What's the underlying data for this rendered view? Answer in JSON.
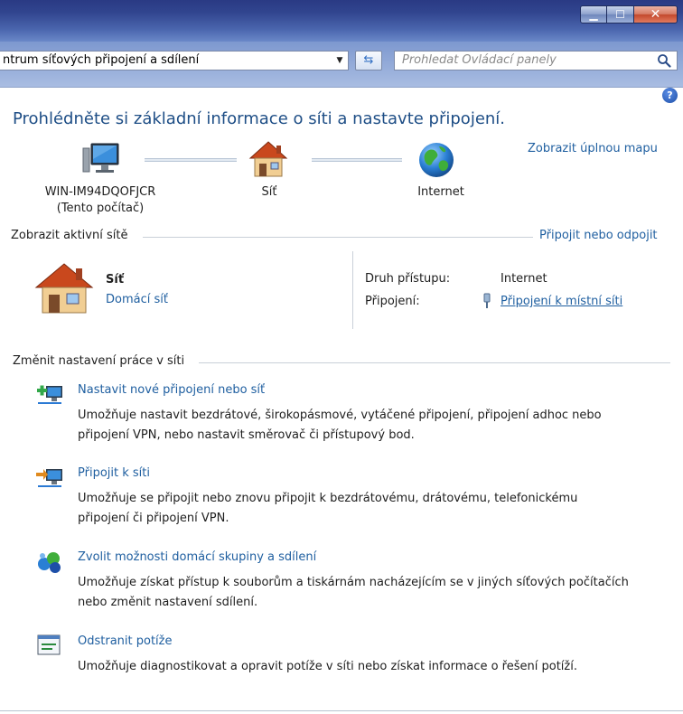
{
  "window": {
    "minimize_glyph": "▁",
    "maximize_glyph": "☐",
    "close_glyph": "✕"
  },
  "address_bar": {
    "path": "ntrum síťových připojení a sdílení",
    "dropdown_glyph": "▼",
    "refresh_glyph": "⇆",
    "search_placeholder": "Prohledat Ovládací panely"
  },
  "help_glyph": "?",
  "page_title": "Prohlédněte si základní informace o síti a nastavte připojení.",
  "full_map_link": "Zobrazit úplnou mapu",
  "network_map": {
    "computer": {
      "name": "WIN-IM94DQOFJCR",
      "subtitle": "(Tento počítač)"
    },
    "network": {
      "name": "Síť"
    },
    "internet": {
      "name": "Internet"
    }
  },
  "active_networks": {
    "header": "Zobrazit aktivní sítě",
    "connect_link": "Připojit nebo odpojit",
    "network_name": "Síť",
    "network_type": "Domácí síť",
    "access_type_label": "Druh přístupu:",
    "access_type_value": "Internet",
    "connection_label": "Připojení:",
    "connection_value": "Připojení k místní síti"
  },
  "change_settings": {
    "header": "Změnit nastavení práce v síti",
    "tasks": [
      {
        "title": "Nastavit nové připojení nebo síť",
        "desc1": "Umožňuje nastavit bezdrátové, širokopásmové, vytáčené připojení, připojení adhoc nebo",
        "desc2": "připojení VPN, nebo nastavit směrovač či přístupový bod."
      },
      {
        "title": "Připojit k síti",
        "desc1": "Umožňuje se připojit nebo znovu připojit k bezdrátovému, drátovému, telefonickému",
        "desc2": "připojení či připojení VPN."
      },
      {
        "title": "Zvolit možnosti domácí skupiny a sdílení",
        "desc1": "Umožňuje získat přístup k souborům a tiskárnám nacházejícím se v jiných síťových počítačích",
        "desc2": "nebo změnit nastavení sdílení."
      },
      {
        "title": "Odstranit potíže",
        "desc1": "Umožňuje diagnostikovat a opravit potíže v síti nebo získat informace o řešení potíží."
      }
    ]
  }
}
